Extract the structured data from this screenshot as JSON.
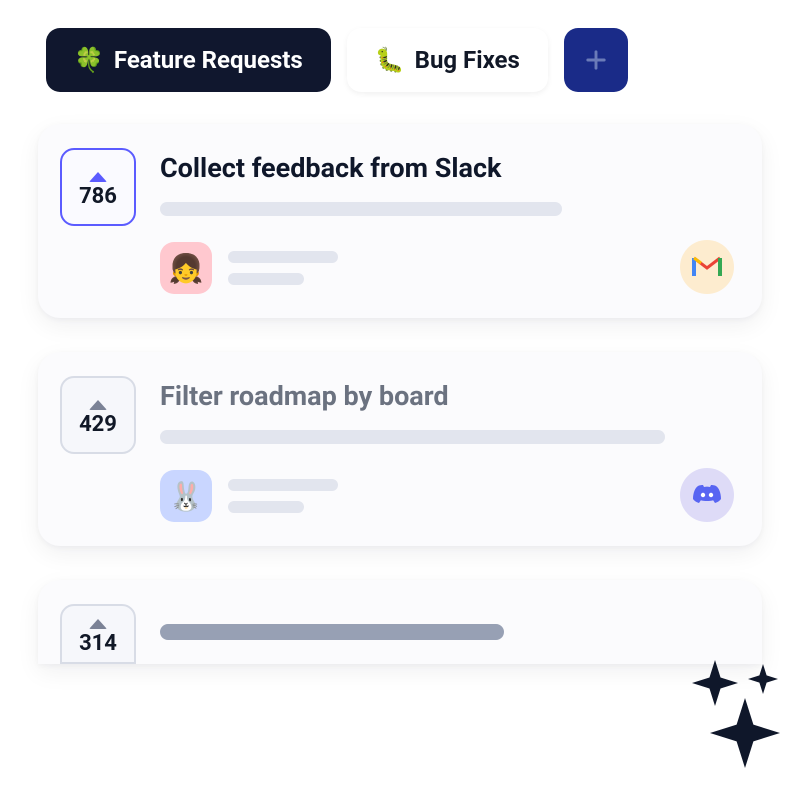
{
  "tabs": {
    "feature_requests": {
      "emoji": "🍀",
      "label": "Feature Requests"
    },
    "bug_fixes": {
      "emoji": "🐛",
      "label": "Bug Fixes"
    }
  },
  "cards": [
    {
      "votes": "786",
      "voted": true,
      "title": "Collect feedback from Slack",
      "avatar_emoji": "👧",
      "avatar_color": "pink",
      "source": "gmail"
    },
    {
      "votes": "429",
      "voted": false,
      "title": "Filter roadmap by board",
      "avatar_emoji": "🐰",
      "avatar_color": "blue",
      "source": "discord"
    },
    {
      "votes": "314",
      "voted": false,
      "title": "",
      "avatar_emoji": "",
      "avatar_color": "",
      "source": ""
    }
  ]
}
